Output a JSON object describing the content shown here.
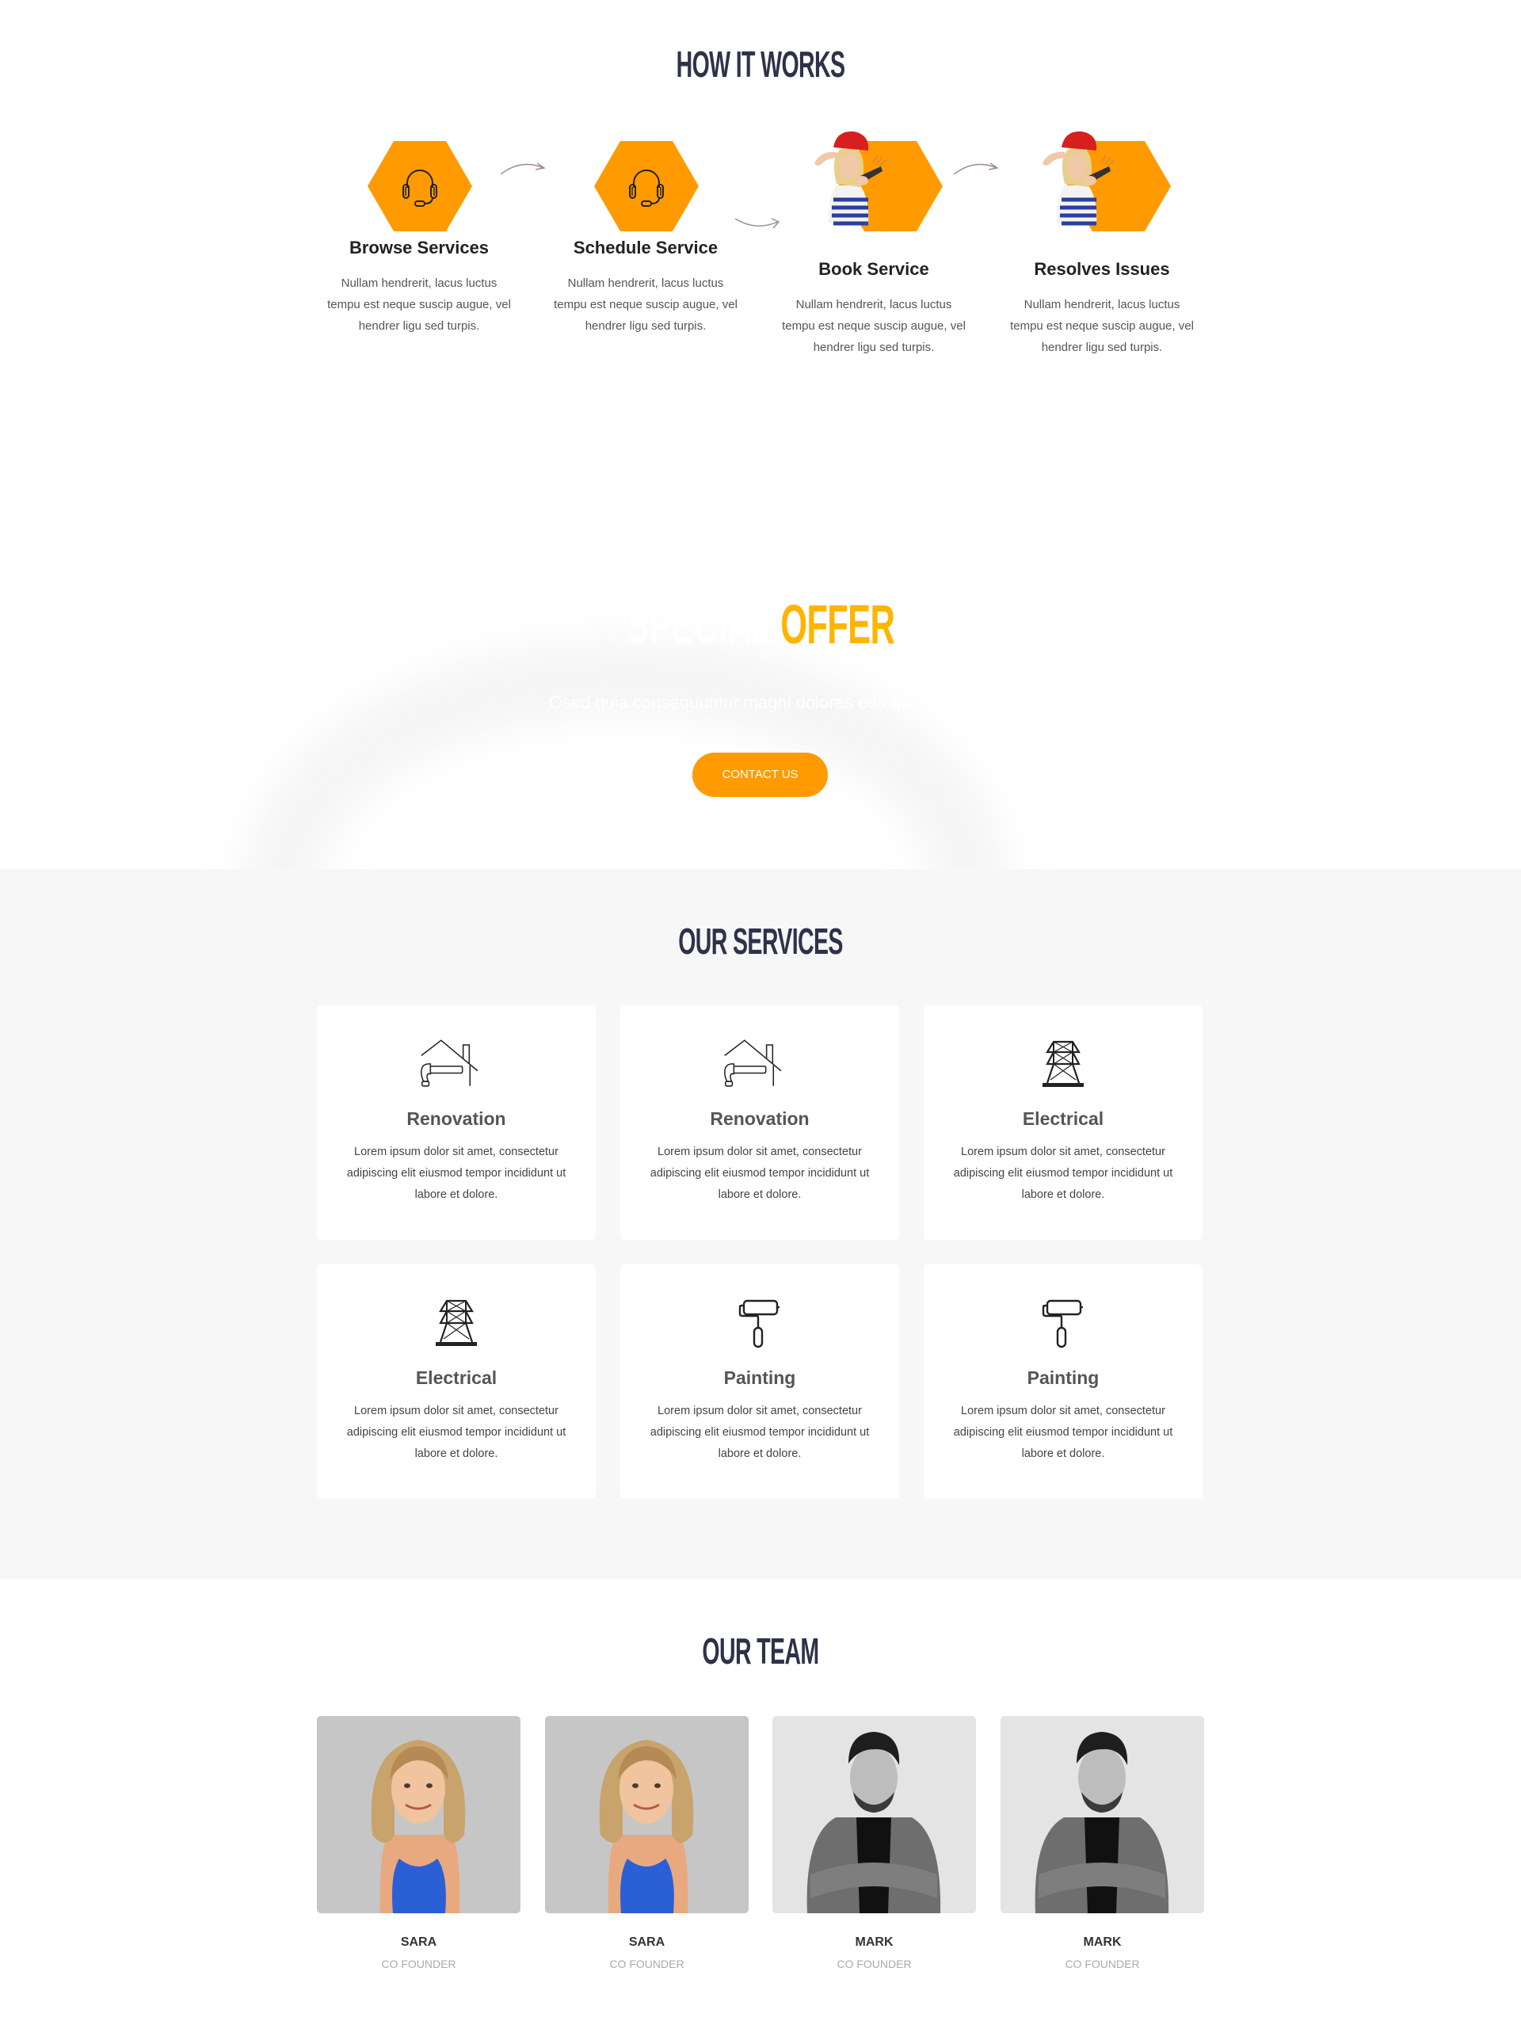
{
  "how_it_works": {
    "title": "HOW IT WORKS",
    "accent_color": "#ff9b00",
    "steps": [
      {
        "icon": "headset-icon",
        "title": "Browse Services",
        "description": "Nullam hendrerit, lacus luctus tempu est neque suscip augue, vel hendrer ligu sed turpis."
      },
      {
        "icon": "headset-icon",
        "title": "Schedule Service",
        "description": "Nullam hendrerit, lacus luctus tempu est neque suscip augue, vel hendrer ligu sed turpis."
      },
      {
        "icon": "worker-photo",
        "title": "Book Service",
        "description": "Nullam hendrerit, lacus luctus tempu est neque suscip augue, vel hendrer ligu sed turpis."
      },
      {
        "icon": "worker-photo",
        "title": "Resolves Issues",
        "description": "Nullam hendrerit, lacus luctus tempu est neque suscip augue, vel hendrer ligu sed turpis."
      }
    ]
  },
  "offer": {
    "title_white": "SPECIAL ",
    "title_accent": "OFFER",
    "accent_color": "#ffb400",
    "subtitle": "Osed quia consequuntur magni dolores eos qui ratione",
    "button_label": "CONTACT US",
    "button_color": "#ff9b00"
  },
  "services": {
    "title": "OUR SERVICES",
    "items": [
      {
        "icon": "house-hammer-icon",
        "title": "Renovation",
        "description": "Lorem ipsum dolor sit amet, consectetur adipiscing elit eiusmod tempor incididunt ut labore et dolore."
      },
      {
        "icon": "house-hammer-icon",
        "title": "Renovation",
        "description": "Lorem ipsum dolor sit amet, consectetur adipiscing elit eiusmod tempor incididunt ut labore et dolore."
      },
      {
        "icon": "power-tower-icon",
        "title": "Electrical",
        "description": "Lorem ipsum dolor sit amet, consectetur adipiscing elit eiusmod tempor incididunt ut labore et dolore."
      },
      {
        "icon": "power-tower-icon",
        "title": "Electrical",
        "description": "Lorem ipsum dolor sit amet, consectetur adipiscing elit eiusmod tempor incididunt ut labore et dolore."
      },
      {
        "icon": "paint-roller-icon",
        "title": "Painting",
        "description": "Lorem ipsum dolor sit amet, consectetur adipiscing elit eiusmod tempor incididunt ut labore et dolore."
      },
      {
        "icon": "paint-roller-icon",
        "title": "Painting",
        "description": "Lorem ipsum dolor sit amet, consectetur adipiscing elit eiusmod tempor incididunt ut labore et dolore."
      }
    ]
  },
  "team": {
    "title": "OUR TEAM",
    "members": [
      {
        "name": "SARA",
        "role": "CO FOUNDER"
      },
      {
        "name": "SARA",
        "role": "CO FOUNDER"
      },
      {
        "name": "MARK",
        "role": "CO FOUNDER"
      },
      {
        "name": "MARK",
        "role": "CO FOUNDER"
      }
    ]
  }
}
